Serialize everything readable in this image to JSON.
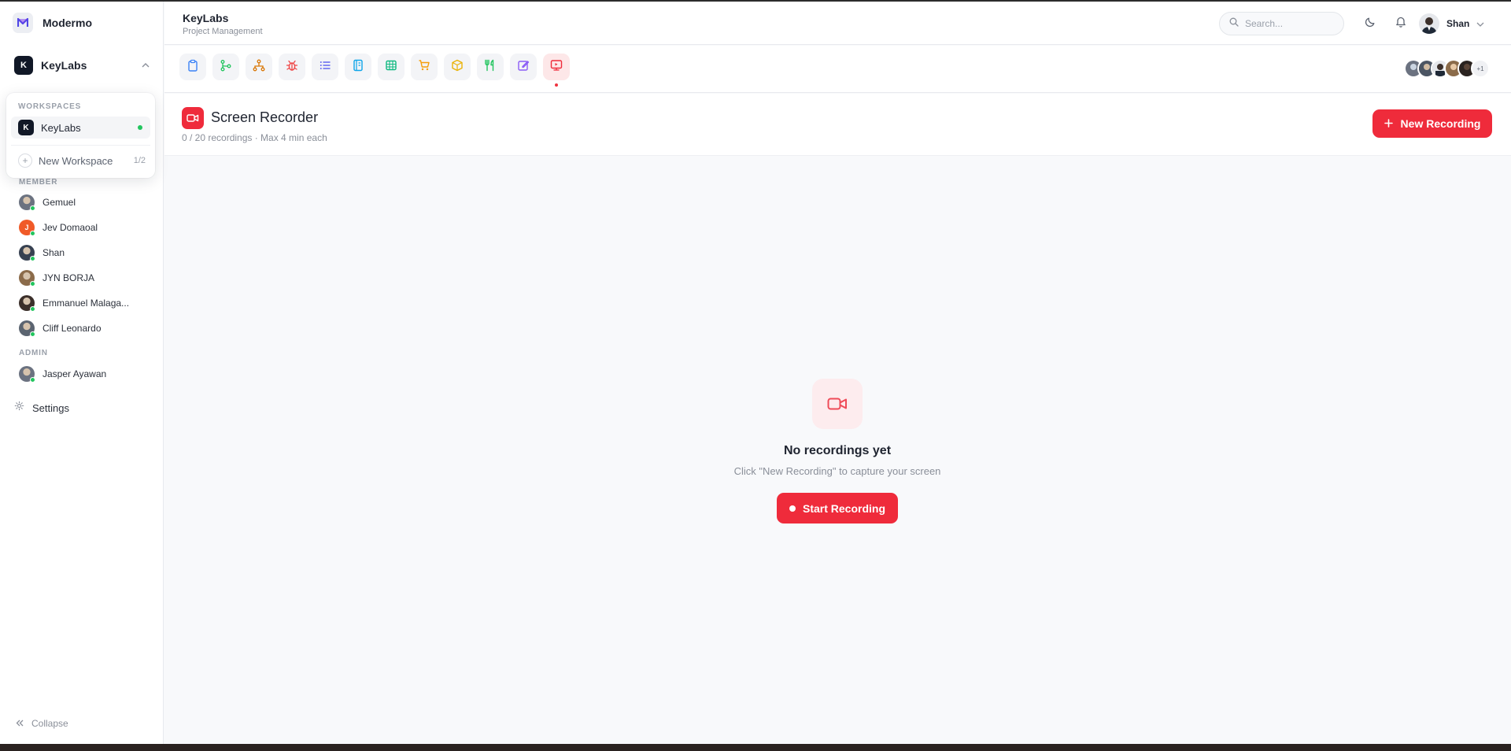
{
  "app": {
    "name": "Modermo"
  },
  "sidebar": {
    "current_workspace": {
      "initial": "K",
      "name": "KeyLabs"
    },
    "dropdown": {
      "label": "WORKSPACES",
      "items": [
        {
          "initial": "K",
          "name": "KeyLabs",
          "active": true
        }
      ],
      "new_label": "New Workspace",
      "count": "1/2"
    },
    "member_label": "MEMBER",
    "members": [
      {
        "name": "Gemuel",
        "color": "#6b7280"
      },
      {
        "name": "Jev Domaoal",
        "color": "#f05a28",
        "initial": "J"
      },
      {
        "name": "Shan",
        "color": "#374151"
      },
      {
        "name": "JYN BORJA",
        "color": "#8b6b4a"
      },
      {
        "name": "Emmanuel Malaga...",
        "color": "#3b2f2a"
      },
      {
        "name": "Cliff Leonardo",
        "color": "#5b6470"
      }
    ],
    "admin_label": "ADMIN",
    "admins": [
      {
        "name": "Jasper Ayawan",
        "color": "#6b7280"
      }
    ],
    "settings_label": "Settings",
    "collapse_label": "Collapse"
  },
  "header": {
    "title": "KeyLabs",
    "subtitle": "Project Management",
    "search_placeholder": "Search...",
    "user_name": "Shan"
  },
  "toolbar": {
    "tools": [
      {
        "icon": "clipboard-icon",
        "color": "#3b82f6"
      },
      {
        "icon": "git-branch-icon",
        "color": "#22c55e"
      },
      {
        "icon": "hierarchy-icon",
        "color": "#d97706"
      },
      {
        "icon": "bug-icon",
        "color": "#ef4444"
      },
      {
        "icon": "list-icon",
        "color": "#6366f1"
      },
      {
        "icon": "notebook-icon",
        "color": "#0ea5e9"
      },
      {
        "icon": "table-icon",
        "color": "#10b981"
      },
      {
        "icon": "cart-icon",
        "color": "#f59e0b"
      },
      {
        "icon": "package-icon",
        "color": "#eab308"
      },
      {
        "icon": "utensils-icon",
        "color": "#22c55e"
      },
      {
        "icon": "edit-icon",
        "color": "#8b5cf6"
      },
      {
        "icon": "screen-recorder-icon",
        "color": "#ef2b3b",
        "active": true
      }
    ],
    "team_more": "+1"
  },
  "page": {
    "title": "Screen Recorder",
    "subtitle": "0 / 20 recordings · Max 4 min each",
    "new_button": "New Recording"
  },
  "empty_state": {
    "title": "No recordings yet",
    "subtitle": "Click \"New Recording\" to capture your screen",
    "button": "Start Recording"
  },
  "colors": {
    "accent": "#ef2b3b",
    "online": "#22c55e"
  }
}
